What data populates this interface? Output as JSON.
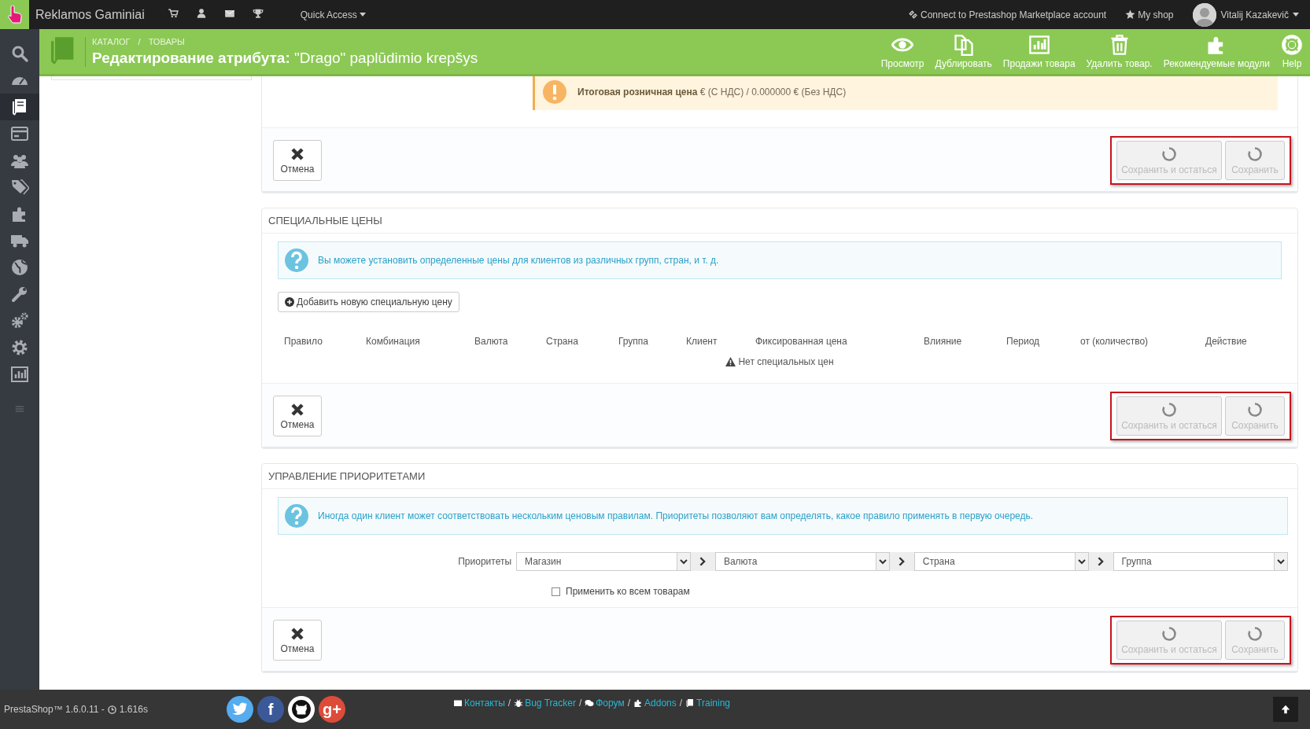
{
  "top_bar": {
    "shop_name": "Reklamos Gaminiai",
    "icons": [
      {
        "kind": "cart"
      },
      {
        "kind": "user"
      },
      {
        "kind": "envelope"
      },
      {
        "kind": "trophy"
      }
    ],
    "quick_access": "Quick Access",
    "marketplace": "Connect to Prestashop Marketplace account",
    "my_shop": "My shop",
    "user_name": "Vitalij Kazakevič"
  },
  "sidebar": {
    "items": [
      {
        "kind": "search",
        "selected": false
      },
      {
        "kind": "dashboard",
        "selected": false
      },
      {
        "kind": "catalog",
        "selected": true
      },
      {
        "kind": "orders",
        "selected": false
      },
      {
        "kind": "customers",
        "selected": false
      },
      {
        "kind": "price-rules",
        "selected": false
      },
      {
        "kind": "modules",
        "selected": false
      },
      {
        "kind": "shipping",
        "selected": false
      },
      {
        "kind": "localization",
        "selected": false
      },
      {
        "kind": "preferences",
        "selected": false
      },
      {
        "kind": "advanced",
        "selected": false
      },
      {
        "kind": "administration",
        "selected": false
      },
      {
        "kind": "stats",
        "selected": false
      },
      {
        "kind": "collapse",
        "selected": false
      }
    ]
  },
  "header": {
    "breadcrumbs": [
      "КАТАЛОГ",
      "ТОВАРЫ"
    ],
    "breadcrumb_separator": "/",
    "title": "**Редактирование атрибута:** \"Drago\" paplūdimio krepšys",
    "toolbar": [
      {
        "kind": "eye",
        "label": "Просмотр"
      },
      {
        "kind": "copy",
        "label": "Дублировать"
      },
      {
        "kind": "chart",
        "label": "Продажи товара"
      },
      {
        "kind": "trash",
        "label": "Удалить товар."
      },
      {
        "kind": "puzzle",
        "label": "Рекомендуемые модули"
      },
      {
        "kind": "lifebuoy",
        "label": "Help"
      }
    ]
  },
  "price_panel": {
    "notice": "**Итоговая розничная цена** € (С НДС) / 0.000000 € (Без НДС)",
    "footer": {
      "highlighted": true,
      "cancel": "Отмена",
      "save_stay": {
        "label": "Сохранить и остаться",
        "disabled": true
      },
      "save": {
        "label": "Сохранить",
        "disabled": true
      }
    }
  },
  "special_prices": {
    "heading": "СПЕЦИАЛЬНЫЕ ЦЕНЫ",
    "info": "Вы можете установить определенные цены для клиентов из различных групп, стран, и т. д.",
    "add_button": "Добавить новую специальную цену",
    "table": {
      "columns": [
        "Правило",
        "Комбинация",
        "Валюта",
        "Страна",
        "Группа",
        "Клиент",
        "Фиксированная цена",
        "Влияние",
        "Период",
        "от (количество)",
        "Действие"
      ],
      "empty_message": "Нет специальных цен"
    },
    "footer": {
      "highlighted": true,
      "cancel": "Отмена",
      "save_stay": {
        "label": "Сохранить и остаться",
        "disabled": true
      },
      "save": {
        "label": "Сохранить",
        "disabled": true
      }
    }
  },
  "priorities": {
    "heading": "УПРАВЛЕНИЕ ПРИОРИТЕТАМИ",
    "info": "Иногда один клиент может соответствовать нескольким ценовым правилам. Приоритеты позволяют вам определять, какое правило применять в первую очередь.",
    "label": "Приоритеты",
    "selects": [
      {
        "value": "Магазин"
      },
      {
        "value": "Валюта"
      },
      {
        "value": "Страна"
      },
      {
        "value": "Группа"
      }
    ],
    "apply_all": {
      "label": "Применить ко всем товарам",
      "checked": false
    },
    "footer": {
      "highlighted": true,
      "cancel": "Отмена",
      "save_stay": {
        "label": "Сохранить и остаться",
        "disabled": true
      },
      "save": {
        "label": "Сохранить",
        "disabled": true
      }
    }
  },
  "page_footer": {
    "version": "PrestaShop™ 1.6.0.11 -",
    "load_time": "1.616s",
    "social": [
      {
        "kind": "twitter"
      },
      {
        "kind": "facebook",
        "glyph": "f"
      },
      {
        "kind": "github"
      },
      {
        "kind": "googleplus",
        "glyph": "g+"
      }
    ],
    "links": [
      {
        "kind": "envelope",
        "label": "Контакты",
        "separator": "/"
      },
      {
        "kind": "bug",
        "label": "Bug Tracker",
        "separator": "/"
      },
      {
        "kind": "comments",
        "label": "Форум",
        "separator": "/"
      },
      {
        "kind": "puzzle",
        "label": "Addons",
        "separator": "/"
      },
      {
        "kind": "book",
        "label": "Training"
      }
    ]
  }
}
